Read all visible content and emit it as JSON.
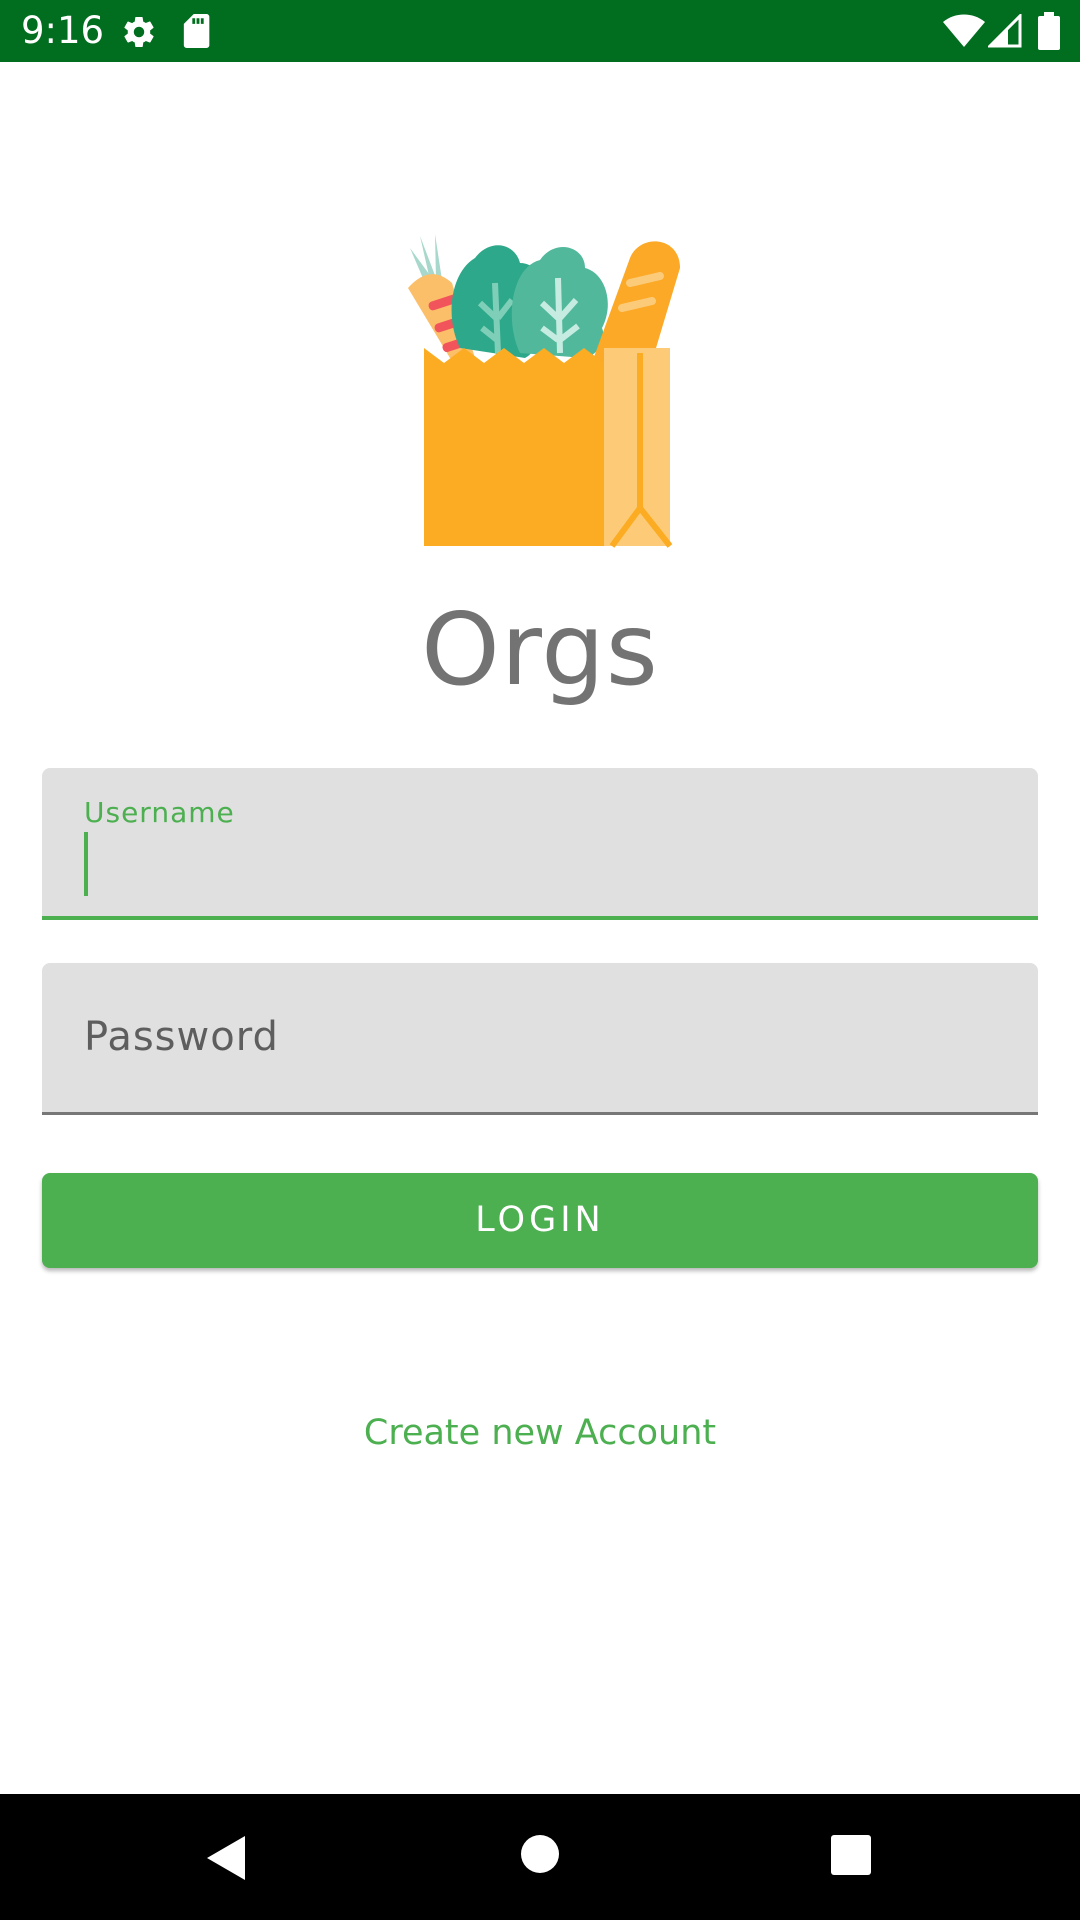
{
  "status_bar": {
    "time": "9:16",
    "icons": [
      "gear-icon",
      "sd-card-icon",
      "wifi-icon",
      "signal-icon",
      "battery-icon"
    ],
    "background_color": "#006e1e"
  },
  "app": {
    "logo_icon": "grocery-bag-icon",
    "title": "Orgs"
  },
  "form": {
    "username_label": "Username",
    "username_value": "",
    "password_label": "Password",
    "password_value": ""
  },
  "actions": {
    "login_label": "LOGIN",
    "create_account_label": "Create new Account"
  },
  "nav_bar": {
    "icons": [
      "back-icon",
      "home-icon",
      "recents-icon"
    ]
  },
  "colors": {
    "accent": "#4caf50",
    "field_background": "#e0e0e0",
    "title_text": "#737373"
  }
}
